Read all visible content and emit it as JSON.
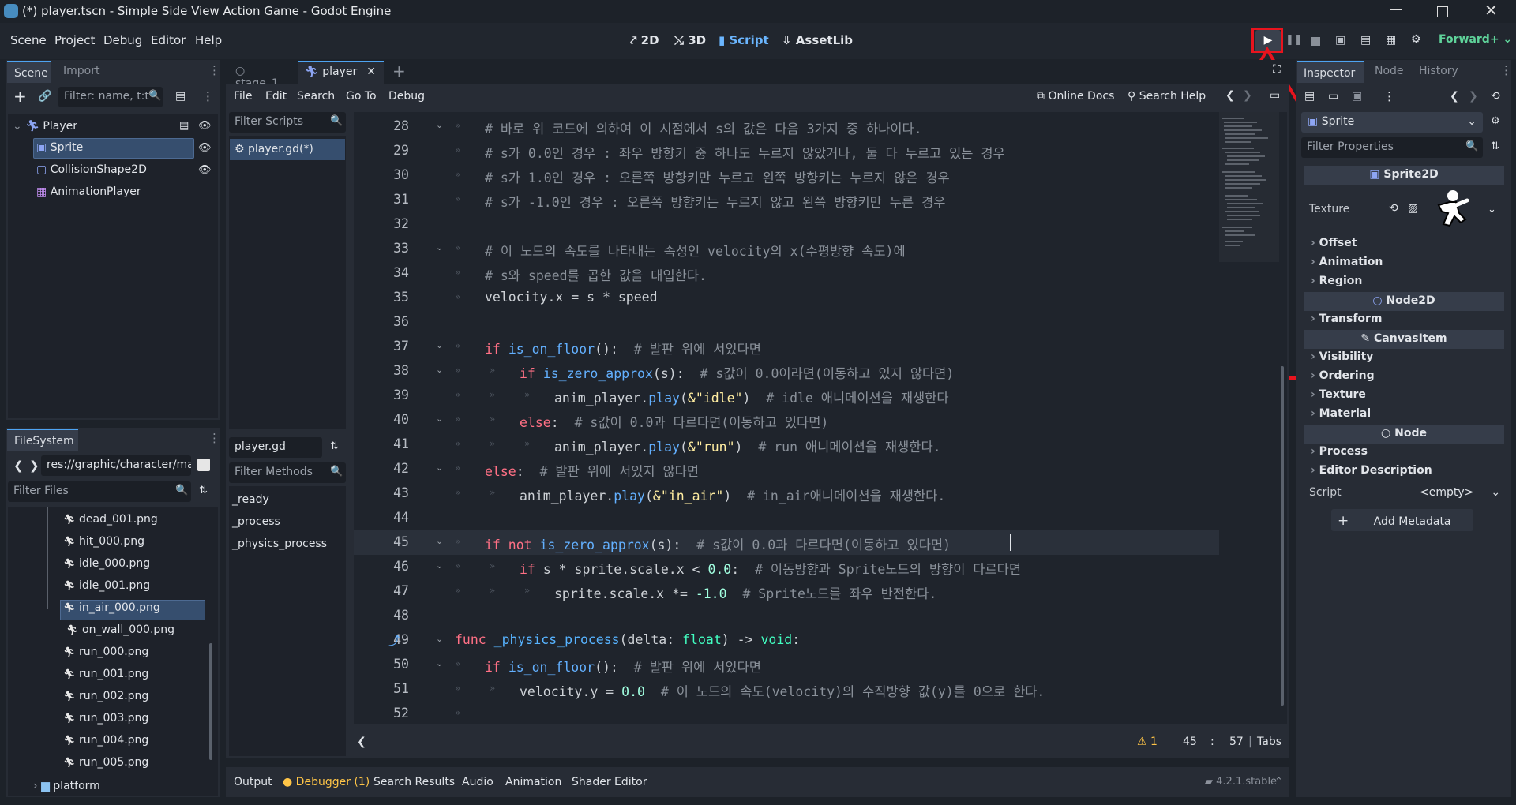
{
  "window": {
    "title": "(*) player.tscn - Simple Side View Action Game - Godot Engine"
  },
  "menu": [
    "Scene",
    "Project",
    "Debug",
    "Editor",
    "Help"
  ],
  "workspaces": [
    "2D",
    "3D",
    "Script",
    "AssetLib"
  ],
  "renderer": "Forward+",
  "scene_dock": {
    "tabs": [
      "Scene",
      "Import"
    ],
    "filter_placeholder": "Filter: name, t:t",
    "nodes": [
      {
        "name": "Player"
      },
      {
        "name": "Sprite"
      },
      {
        "name": "CollisionShape2D"
      },
      {
        "name": "AnimationPlayer"
      }
    ]
  },
  "filesystem": {
    "tab": "FileSystem",
    "path": "res://graphic/character/mai",
    "filter_placeholder": "Filter Files",
    "files": [
      "dead_001.png",
      "hit_000.png",
      "idle_000.png",
      "idle_001.png",
      "in_air_000.png",
      "on_wall_000.png",
      "run_000.png",
      "run_001.png",
      "run_002.png",
      "run_003.png",
      "run_004.png",
      "run_005.png"
    ],
    "folder": "platform"
  },
  "editor_tabs": [
    "stage_1",
    "player"
  ],
  "script_menu": [
    "File",
    "Edit",
    "Search",
    "Go To",
    "Debug"
  ],
  "script_toolbar": {
    "online_docs": "Online Docs",
    "search_help": "Search Help"
  },
  "script_list": {
    "filter_placeholder": "Filter Scripts",
    "scripts": [
      "player.gd(*)"
    ],
    "current": "player.gd",
    "methods_placeholder": "Filter Methods",
    "methods": [
      "_ready",
      "_process",
      "_physics_process"
    ]
  },
  "code": {
    "lines": [
      {
        "n": "28",
        "indent": 1,
        "parts": [
          [
            "c-com",
            "# 바로 위 코드에 의하여 이 시점에서 s의 값은 다음 3가지 중 하나이다."
          ]
        ]
      },
      {
        "n": "29",
        "indent": 1,
        "parts": [
          [
            "c-com",
            "# s가 0.0인 경우 : 좌우 방향키 중 하나도 누르지 않았거나, 둘 다 누르고 있는 경우"
          ]
        ]
      },
      {
        "n": "30",
        "indent": 1,
        "parts": [
          [
            "c-com",
            "# s가 1.0인 경우 : 오른쪽 방향키만 누르고 왼쪽 방향키는 누르지 않은 경우"
          ]
        ]
      },
      {
        "n": "31",
        "indent": 1,
        "parts": [
          [
            "c-com",
            "# s가 -1.0인 경우 : 오른쪽 방향키는 누르지 않고 왼쪽 방향키만 누른 경우"
          ]
        ]
      },
      {
        "n": "32",
        "indent": 0,
        "parts": []
      },
      {
        "n": "33",
        "indent": 1,
        "parts": [
          [
            "c-com",
            "# 이 노드의 속도를 나타내는 속성인 velocity의 x(수평방향 속도)에"
          ]
        ]
      },
      {
        "n": "34",
        "indent": 1,
        "parts": [
          [
            "c-com",
            "# s와 speed를 곱한 값을 대입한다."
          ]
        ]
      },
      {
        "n": "35",
        "indent": 1,
        "parts": [
          [
            "c-def",
            "velocity.x = s * speed"
          ]
        ]
      },
      {
        "n": "36",
        "indent": 0,
        "parts": []
      },
      {
        "n": "37",
        "indent": 1,
        "parts": [
          [
            "c-kw",
            "if "
          ],
          [
            "c-fn",
            "is_on_floor"
          ],
          [
            "c-def",
            "():  "
          ],
          [
            "c-com",
            "# 발판 위에 서있다면"
          ]
        ]
      },
      {
        "n": "38",
        "indent": 2,
        "parts": [
          [
            "c-kw",
            "if "
          ],
          [
            "c-fn",
            "is_zero_approx"
          ],
          [
            "c-def",
            "(s):  "
          ],
          [
            "c-com",
            "# s값이 0.0이라면(이동하고 있지 않다면)"
          ]
        ]
      },
      {
        "n": "39",
        "indent": 3,
        "parts": [
          [
            "c-def",
            "anim_player."
          ],
          [
            "c-fn",
            "play"
          ],
          [
            "c-def",
            "("
          ],
          [
            "c-str",
            "&\"idle\""
          ],
          [
            "c-def",
            ")  "
          ],
          [
            "c-com",
            "# idle 애니메이션을 재생한다"
          ]
        ]
      },
      {
        "n": "40",
        "indent": 2,
        "parts": [
          [
            "c-kw",
            "else"
          ],
          [
            "c-def",
            ":  "
          ],
          [
            "c-com",
            "# s값이 0.0과 다르다면(이동하고 있다면)"
          ]
        ]
      },
      {
        "n": "41",
        "indent": 3,
        "parts": [
          [
            "c-def",
            "anim_player."
          ],
          [
            "c-fn",
            "play"
          ],
          [
            "c-def",
            "("
          ],
          [
            "c-str",
            "&\"run\""
          ],
          [
            "c-def",
            ")  "
          ],
          [
            "c-com",
            "# run 애니메이션을 재생한다."
          ]
        ]
      },
      {
        "n": "42",
        "indent": 1,
        "parts": [
          [
            "c-kw",
            "else"
          ],
          [
            "c-def",
            ":  "
          ],
          [
            "c-com",
            "# 발판 위에 서있지 않다면"
          ]
        ]
      },
      {
        "n": "43",
        "indent": 2,
        "parts": [
          [
            "c-def",
            "anim_player."
          ],
          [
            "c-fn",
            "play"
          ],
          [
            "c-def",
            "("
          ],
          [
            "c-str",
            "&\"in_air\""
          ],
          [
            "c-def",
            ")  "
          ],
          [
            "c-com",
            "# in_air애니메이션을 재생한다."
          ]
        ]
      },
      {
        "n": "44",
        "indent": 0,
        "parts": []
      },
      {
        "n": "45",
        "indent": 1,
        "parts": [
          [
            "c-kw",
            "if not "
          ],
          [
            "c-fn",
            "is_zero_approx"
          ],
          [
            "c-def",
            "(s):  "
          ],
          [
            "c-com",
            "# s값이 0.0과 다르다면(이동하고 있다면)"
          ]
        ]
      },
      {
        "n": "46",
        "indent": 2,
        "parts": [
          [
            "c-kw",
            "if "
          ],
          [
            "c-def",
            "s * sprite.scale.x < "
          ],
          [
            "c-num",
            "0.0"
          ],
          [
            "c-def",
            ":  "
          ],
          [
            "c-com",
            "# 이동방향과 Sprite노드의 방향이 다르다면"
          ]
        ]
      },
      {
        "n": "47",
        "indent": 3,
        "parts": [
          [
            "c-def",
            "sprite.scale.x *= "
          ],
          [
            "c-num",
            "-1.0"
          ],
          [
            "c-def",
            "  "
          ],
          [
            "c-com",
            "# Sprite노드를 좌우 반전한다."
          ]
        ]
      },
      {
        "n": "48",
        "indent": 0,
        "parts": []
      },
      {
        "n": "49",
        "indent": 0,
        "parts": [
          [
            "c-kw",
            "func "
          ],
          [
            "c-fnname",
            "_physics_process"
          ],
          [
            "c-def",
            "(delta: "
          ],
          [
            "c-type",
            "float"
          ],
          [
            "c-def",
            ") -> "
          ],
          [
            "c-type",
            "void"
          ],
          [
            "c-def",
            ":"
          ]
        ]
      },
      {
        "n": "50",
        "indent": 1,
        "parts": [
          [
            "c-kw",
            "if "
          ],
          [
            "c-fn",
            "is_on_floor"
          ],
          [
            "c-def",
            "():  "
          ],
          [
            "c-com",
            "# 발판 위에 서있다면"
          ]
        ]
      },
      {
        "n": "51",
        "indent": 2,
        "parts": [
          [
            "c-def",
            "velocity.y = "
          ],
          [
            "c-num",
            "0.0"
          ],
          [
            "c-def",
            "  "
          ],
          [
            "c-com",
            "# 이 노드의 속도(velocity)의 수직방향 값(y)를 0으로 한다."
          ]
        ]
      },
      {
        "n": "52",
        "indent": 1,
        "parts": []
      }
    ]
  },
  "status": {
    "warnings": "1",
    "line": "45",
    "col": "57",
    "indent_mode": "Tabs"
  },
  "bottom_tabs": [
    "Output",
    "Debugger (1)",
    "Search Results",
    "Audio",
    "Animation",
    "Shader Editor"
  ],
  "version": "4.2.1.stable",
  "inspector": {
    "tabs": [
      "Inspector",
      "Node",
      "History"
    ],
    "object": "Sprite",
    "filter_placeholder": "Filter Properties",
    "class_sprite": "Sprite2D",
    "texture_label": "Texture",
    "sprite_props": [
      "Offset",
      "Animation",
      "Region"
    ],
    "class_node2d": "Node2D",
    "node2d_props": [
      "Transform"
    ],
    "class_canvas": "CanvasItem",
    "canvas_props": [
      "Visibility",
      "Ordering",
      "Texture",
      "Material"
    ],
    "class_node": "Node",
    "node_props": [
      "Process",
      "Editor Description"
    ],
    "script_label": "Script",
    "script_value": "<empty>",
    "add_metadata": "Add Metadata"
  },
  "colors": {
    "annotation": "#e8141e",
    "accent": "#4ea4f2",
    "selection": "#364e6e"
  }
}
